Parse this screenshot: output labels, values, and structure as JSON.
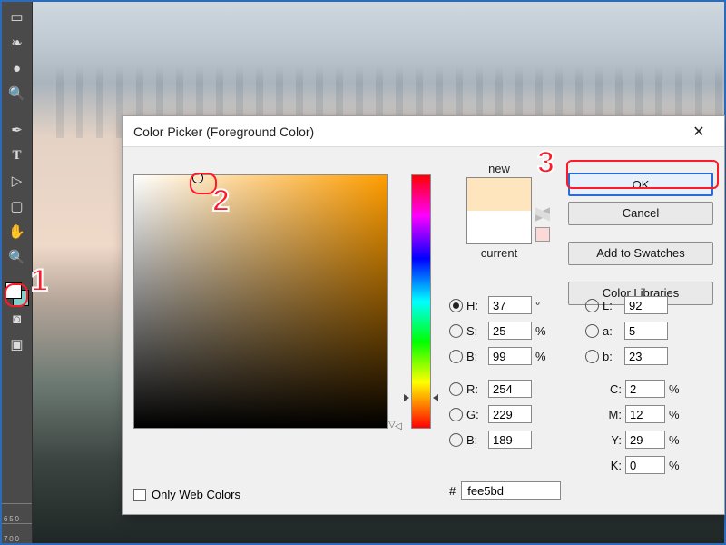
{
  "annotations": {
    "n1": "1",
    "n2": "2",
    "n3": "3"
  },
  "dialog": {
    "title": "Color Picker (Foreground Color)",
    "buttons": {
      "ok": "OK",
      "cancel": "Cancel",
      "add_swatches": "Add to Swatches",
      "color_libraries": "Color Libraries"
    },
    "swatch": {
      "new_label": "new",
      "current_label": "current"
    },
    "hsb": {
      "h_label": "H:",
      "h_val": "37",
      "h_unit": "°",
      "s_label": "S:",
      "s_val": "25",
      "s_unit": "%",
      "b_label": "B:",
      "b_val": "99",
      "b_unit": "%"
    },
    "rgb": {
      "r_label": "R:",
      "r_val": "254",
      "g_label": "G:",
      "g_val": "229",
      "b_label": "B:",
      "b_val": "189"
    },
    "lab": {
      "l_label": "L:",
      "l_val": "92",
      "a_label": "a:",
      "a_val": "5",
      "b_label": "b:",
      "b_val": "23"
    },
    "cmyk": {
      "c_label": "C:",
      "c_val": "2",
      "c_unit": "%",
      "m_label": "M:",
      "m_val": "12",
      "m_unit": "%",
      "y_label": "Y:",
      "y_val": "29",
      "y_unit": "%",
      "k_label": "K:",
      "k_val": "0",
      "k_unit": "%"
    },
    "web_only": "Only Web Colors",
    "hex_prefix": "#",
    "hex_val": "fee5bd"
  },
  "ruler": {
    "a": "6 5 0",
    "b": "7 0 0"
  },
  "colors": {
    "foreground": "#fefefe",
    "background_tool": "#7fd0c8",
    "new_swatch": "#fee5bd",
    "current_swatch": "#ffffff",
    "accent": "#2a6bd6",
    "annotation": "#ff1a2a"
  }
}
